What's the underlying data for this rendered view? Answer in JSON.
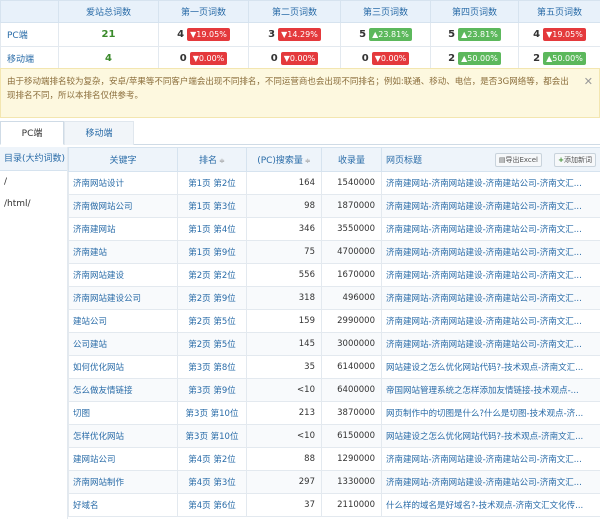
{
  "summary": {
    "headers": [
      "",
      "爱站总词数",
      "第一页词数",
      "第二页词数",
      "第三页词数",
      "第四页词数",
      "第五页词数"
    ],
    "rows": [
      {
        "label": "PC端",
        "total": "21",
        "cells": [
          {
            "num": "4",
            "arrow": "▼",
            "pct": "19.05%",
            "color": "red"
          },
          {
            "num": "3",
            "arrow": "▼",
            "pct": "14.29%",
            "color": "red"
          },
          {
            "num": "5",
            "arrow": "▲",
            "pct": "23.81%",
            "color": "green"
          },
          {
            "num": "5",
            "arrow": "▲",
            "pct": "23.81%",
            "color": "green"
          },
          {
            "num": "4",
            "arrow": "▼",
            "pct": "19.05%",
            "color": "red"
          }
        ]
      },
      {
        "label": "移动端",
        "total": "4",
        "cells": [
          {
            "num": "0",
            "arrow": "▼",
            "pct": "0.00%",
            "color": "red"
          },
          {
            "num": "0",
            "arrow": "▼",
            "pct": "0.00%",
            "color": "red"
          },
          {
            "num": "0",
            "arrow": "▼",
            "pct": "0.00%",
            "color": "red"
          },
          {
            "num": "2",
            "arrow": "▲",
            "pct": "50.00%",
            "color": "green"
          },
          {
            "num": "2",
            "arrow": "▲",
            "pct": "50.00%",
            "color": "green"
          }
        ]
      }
    ]
  },
  "notice": {
    "text": "由于移动端排名较为复杂，安卓/苹果等不同客户端会出现不同排名，不同运营商也会出现不同排名；例如:联通、移动、电信，是否3G网络等，都会出现排名不同，所以本排名仅供参考。",
    "close": "✕"
  },
  "tabs": {
    "pc": "PC端",
    "mobile": "移动端"
  },
  "directory": {
    "header": "目录(大约词数)",
    "items": [
      "/",
      "/html/"
    ]
  },
  "keyword_table": {
    "headers": {
      "keyword": "关键字",
      "rank": "排名",
      "pc_volume": "(PC)搜索量",
      "indexed": "收录量",
      "page_title": "网页标题"
    },
    "sort_glyph": "≑",
    "export_label": "导出Excel",
    "export_icon": "▤",
    "add_label": "添加新词",
    "add_icon": "+",
    "rows": [
      {
        "keyword": "济南网站设计",
        "rank": "第1页 第2位",
        "pc_volume": "164",
        "indexed": "1540000",
        "page_title": "济南建网站-济南网站建设-济南建站公司-济南文汇..."
      },
      {
        "keyword": "济南做网站公司",
        "rank": "第1页 第3位",
        "pc_volume": "98",
        "indexed": "1870000",
        "page_title": "济南建网站-济南网站建设-济南建站公司-济南文汇..."
      },
      {
        "keyword": "济南建网站",
        "rank": "第1页 第4位",
        "pc_volume": "346",
        "indexed": "3550000",
        "page_title": "济南建网站-济南网站建设-济南建站公司-济南文汇..."
      },
      {
        "keyword": "济南建站",
        "rank": "第1页 第9位",
        "pc_volume": "75",
        "indexed": "4700000",
        "page_title": "济南建网站-济南网站建设-济南建站公司-济南文汇..."
      },
      {
        "keyword": "济南网站建设",
        "rank": "第2页 第2位",
        "pc_volume": "556",
        "indexed": "1670000",
        "page_title": "济南建网站-济南网站建设-济南建站公司-济南文汇..."
      },
      {
        "keyword": "济南网站建设公司",
        "rank": "第2页 第9位",
        "pc_volume": "318",
        "indexed": "496000",
        "page_title": "济南建网站-济南网站建设-济南建站公司-济南文汇..."
      },
      {
        "keyword": "建站公司",
        "rank": "第2页 第5位",
        "pc_volume": "159",
        "indexed": "2990000",
        "page_title": "济南建网站-济南网站建设-济南建站公司-济南文汇..."
      },
      {
        "keyword": "公司建站",
        "rank": "第2页 第5位",
        "pc_volume": "145",
        "indexed": "3000000",
        "page_title": "济南建网站-济南网站建设-济南建站公司-济南文汇..."
      },
      {
        "keyword": "如何优化网站",
        "rank": "第3页 第8位",
        "pc_volume": "35",
        "indexed": "6140000",
        "page_title": "网站建设之怎么优化网站代码?-技术观点-济南文汇..."
      },
      {
        "keyword": "怎么做友情链接",
        "rank": "第3页 第9位",
        "pc_volume": "<10",
        "indexed": "6400000",
        "page_title": "帝国网站管理系统之怎样添加友情链接-技术观点-..."
      },
      {
        "keyword": "切图",
        "rank": "第3页 第10位",
        "pc_volume": "213",
        "indexed": "3870000",
        "page_title": "网页制作中的切图是什么?什么是切图-技术观点-济..."
      },
      {
        "keyword": "怎样优化网站",
        "rank": "第3页 第10位",
        "pc_volume": "<10",
        "indexed": "6150000",
        "page_title": "网站建设之怎么优化网站代码?-技术观点-济南文汇..."
      },
      {
        "keyword": "建网站公司",
        "rank": "第4页 第2位",
        "pc_volume": "88",
        "indexed": "1290000",
        "page_title": "济南建网站-济南网站建设-济南建站公司-济南文汇..."
      },
      {
        "keyword": "济南网站制作",
        "rank": "第4页 第3位",
        "pc_volume": "297",
        "indexed": "1330000",
        "page_title": "济南建网站-济南网站建设-济南建站公司-济南文汇..."
      },
      {
        "keyword": "好域名",
        "rank": "第4页 第6位",
        "pc_volume": "37",
        "indexed": "2110000",
        "page_title": "什么样的域名是好域名?-技术观点-济南文汇文化传..."
      }
    ]
  }
}
